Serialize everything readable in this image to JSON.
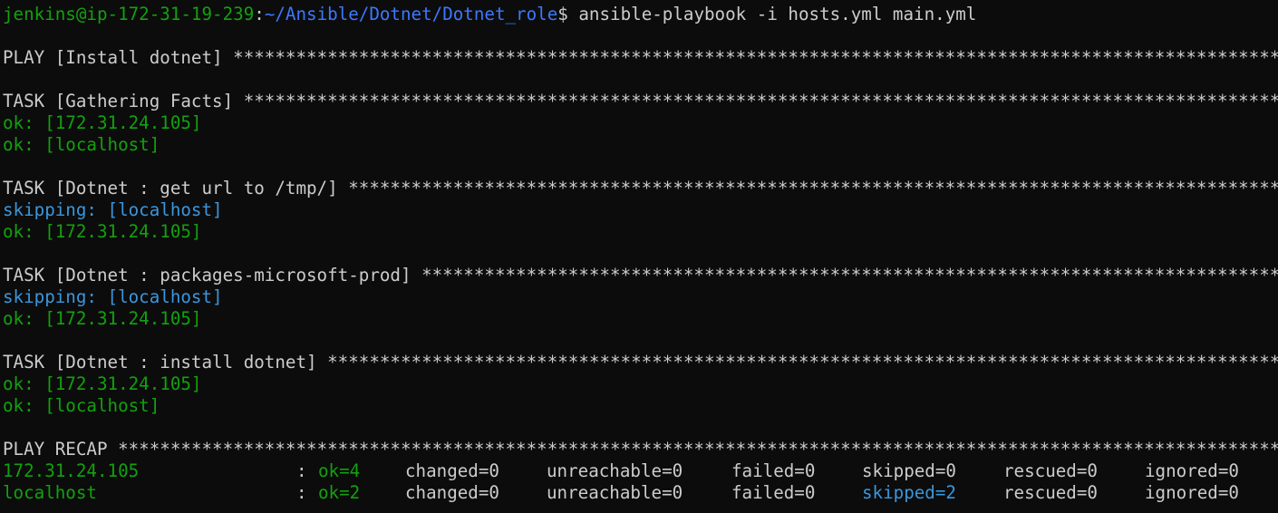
{
  "prompt": {
    "user_host": "jenkins@ip-172-31-19-239",
    "separator": ":",
    "path": "~/Ansible/Dotnet/Dotnet_role",
    "symbol": "$",
    "command": " ansible-playbook -i hosts.yml main.yml"
  },
  "stars": "*************************************************************************************************************************************************************************************************************************",
  "output": [
    {
      "kind": "blank"
    },
    {
      "kind": "header",
      "text": "PLAY [Install dotnet] "
    },
    {
      "kind": "blank"
    },
    {
      "kind": "header",
      "text": "TASK [Gathering Facts] "
    },
    {
      "kind": "result",
      "status": "ok",
      "label": "ok:",
      "host": " [172.31.24.105]"
    },
    {
      "kind": "result",
      "status": "ok",
      "label": "ok:",
      "host": " [localhost]"
    },
    {
      "kind": "blank"
    },
    {
      "kind": "header",
      "text": "TASK [Dotnet : get url to /tmp/] "
    },
    {
      "kind": "result",
      "status": "skipping",
      "label": "skipping:",
      "host": " [localhost]"
    },
    {
      "kind": "result",
      "status": "ok",
      "label": "ok:",
      "host": " [172.31.24.105]"
    },
    {
      "kind": "blank"
    },
    {
      "kind": "header",
      "text": "TASK [Dotnet : packages-microsoft-prod] "
    },
    {
      "kind": "result",
      "status": "skipping",
      "label": "skipping:",
      "host": " [localhost]"
    },
    {
      "kind": "result",
      "status": "ok",
      "label": "ok:",
      "host": " [172.31.24.105]"
    },
    {
      "kind": "blank"
    },
    {
      "kind": "header",
      "text": "TASK [Dotnet : install dotnet] "
    },
    {
      "kind": "result",
      "status": "ok",
      "label": "ok:",
      "host": " [172.31.24.105]"
    },
    {
      "kind": "result",
      "status": "ok",
      "label": "ok:",
      "host": " [localhost]"
    },
    {
      "kind": "blank"
    },
    {
      "kind": "header",
      "text": "PLAY RECAP "
    }
  ],
  "recap": [
    {
      "host": "172.31.24.105",
      "colon": ":",
      "ok": "ok=4",
      "changed": "changed=0",
      "unreachable": "unreachable=0",
      "failed": "failed=0",
      "skipped": "skipped=0",
      "skipped_highlight": false,
      "rescued": "rescued=0",
      "ignored": "ignored=0"
    },
    {
      "host": "localhost",
      "colon": ":",
      "ok": "ok=2",
      "changed": "changed=0",
      "unreachable": "unreachable=0",
      "failed": "failed=0",
      "skipped": "skipped=2",
      "skipped_highlight": true,
      "rescued": "rescued=0",
      "ignored": "ignored=0"
    }
  ],
  "colors": {
    "background": "#0c0c0c",
    "default_text": "#cccccc",
    "ok_green": "#13a10e",
    "path_blue": "#3b78ff",
    "skipping_blue": "#3a96dd"
  }
}
